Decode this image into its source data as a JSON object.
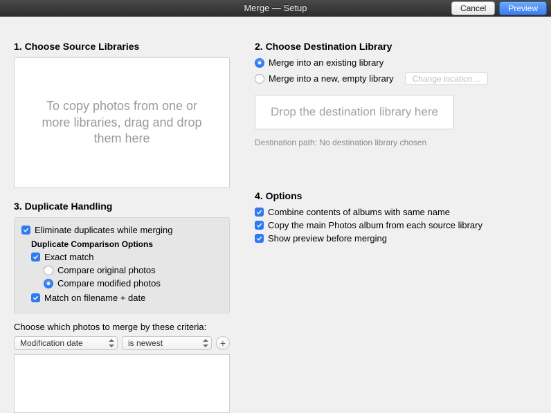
{
  "titlebar": {
    "title": "Merge — Setup",
    "cancel": "Cancel",
    "preview": "Preview"
  },
  "source": {
    "heading": "1. Choose Source Libraries",
    "dropzone_text": "To copy photos from one or more libraries, drag and drop them here"
  },
  "dest": {
    "heading": "2. Choose Destination Library",
    "radio_existing": "Merge into an existing library",
    "radio_new": "Merge into a new, empty library",
    "change_location": "Change location…",
    "dropzone_text": "Drop the destination library here",
    "path_label": "Destination path: No destination library chosen"
  },
  "dup": {
    "heading": "3. Duplicate Handling",
    "eliminate": "Eliminate duplicates while merging",
    "comparison_title": "Duplicate Comparison Options",
    "exact_match": "Exact match",
    "compare_original": "Compare original photos",
    "compare_modified": "Compare modified photos",
    "match_filename": "Match on filename + date",
    "criteria_label": "Choose which photos to merge by these criteria:",
    "select_field": "Modification date",
    "select_op": "is newest"
  },
  "options": {
    "heading": "4. Options",
    "combine": "Combine contents of albums with same name",
    "copy_main": "Copy the main Photos album from each source library",
    "show_preview": "Show preview before merging"
  }
}
